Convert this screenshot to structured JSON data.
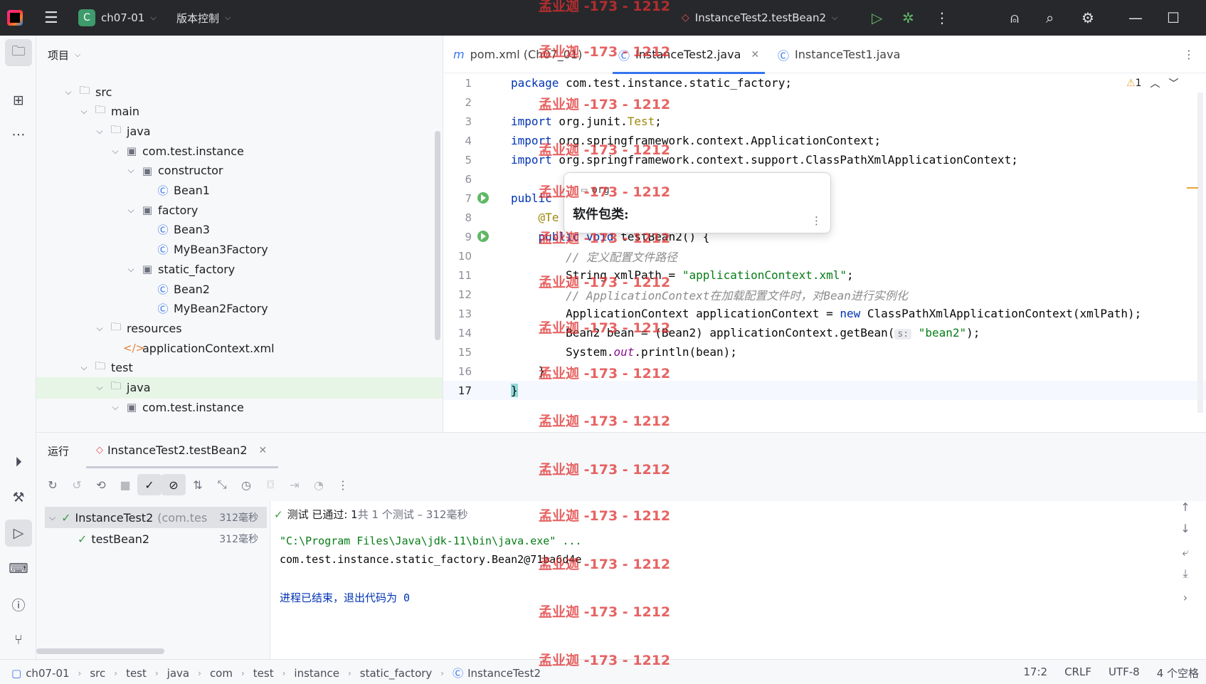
{
  "titlebar": {
    "project_letter": "C",
    "project_name": "ch07-01",
    "vcs_label": "版本控制",
    "run_config": "InstanceTest2.testBean2"
  },
  "project_panel": {
    "title": "项目",
    "tree": [
      {
        "label": "src",
        "depth": 0,
        "icon": "folder-icon"
      },
      {
        "label": "main",
        "depth": 1,
        "icon": "folder-icon"
      },
      {
        "label": "java",
        "depth": 2,
        "icon": "folder-icon"
      },
      {
        "label": "com.test.instance",
        "depth": 3,
        "icon": "package-icon"
      },
      {
        "label": "constructor",
        "depth": 4,
        "icon": "package-icon"
      },
      {
        "label": "Bean1",
        "depth": 5,
        "icon": "class-icon"
      },
      {
        "label": "factory",
        "depth": 4,
        "icon": "package-icon"
      },
      {
        "label": "Bean3",
        "depth": 5,
        "icon": "class-icon"
      },
      {
        "label": "MyBean3Factory",
        "depth": 5,
        "icon": "class-icon"
      },
      {
        "label": "static_factory",
        "depth": 4,
        "icon": "package-icon"
      },
      {
        "label": "Bean2",
        "depth": 5,
        "icon": "class-icon"
      },
      {
        "label": "MyBean2Factory",
        "depth": 5,
        "icon": "class-icon"
      },
      {
        "label": "resources",
        "depth": 2,
        "icon": "folder-icon"
      },
      {
        "label": "applicationContext.xml",
        "depth": 3,
        "icon": "xml-icon"
      },
      {
        "label": "test",
        "depth": 1,
        "icon": "folder-icon"
      },
      {
        "label": "java",
        "depth": 2,
        "icon": "folder-icon"
      },
      {
        "label": "com.test.instance",
        "depth": 3,
        "icon": "package-icon"
      }
    ]
  },
  "editor": {
    "tabs": [
      {
        "label": "pom.xml (Ch07_01)",
        "icon": "maven-icon"
      },
      {
        "label": "InstanceTest2.java",
        "icon": "class-icon",
        "active": true
      },
      {
        "label": "InstanceTest1.java",
        "icon": "class-icon"
      }
    ],
    "warning_count": "1",
    "lines": [
      {
        "n": "1"
      },
      {
        "n": "2"
      },
      {
        "n": "3"
      },
      {
        "n": "4"
      },
      {
        "n": "5"
      },
      {
        "n": "6"
      },
      {
        "n": "7"
      },
      {
        "n": "8"
      },
      {
        "n": "9"
      },
      {
        "n": "10"
      },
      {
        "n": "11"
      },
      {
        "n": "12"
      },
      {
        "n": "13"
      },
      {
        "n": "14"
      },
      {
        "n": "15"
      },
      {
        "n": "16"
      },
      {
        "n": "17"
      }
    ],
    "code": {
      "l1_kw": "package",
      "l1": " com.test.instance.static_factory;",
      "l3_kw": "import",
      "l3a": " org.junit.",
      "l3b": "Test",
      "l3c": ";",
      "l4_kw": "import",
      "l4": " org.springframework.context.ApplicationContext;",
      "l5_kw": "import",
      "l5": " org.springframework.context.support.ClassPathXmlApplicationContext;",
      "l7_kw": "public",
      "l8_ann": "@Te",
      "l9_kw": "public void",
      "l9": " testBean2() {",
      "l10": "// 定义配置文件路径",
      "l11a": "String xmlPath = ",
      "l11b": "\"applicationContext.xml\"",
      "l11c": ";",
      "l12": "// ApplicationContext在加载配置文件时，对Bean进行实例化",
      "l13a": "ApplicationContext applicationContext = ",
      "l13_kw": "new",
      "l13b": " ClassPathXmlApplicationContext(xmlPath);",
      "l14a": "Bean2 bean = (Bean2) applicationContext.getBean(",
      "l14_hint": "s:",
      "l14b": "\"bean2\"",
      "l14c": ");",
      "l15a": "System.",
      "l15_fld": "out",
      "l15b": ".println(bean);",
      "l16": "}",
      "l17": "}"
    },
    "popup": {
      "package": "org",
      "title": "软件包类:"
    }
  },
  "run_panel": {
    "title": "运行",
    "tab": "InstanceTest2.testBean2",
    "tests": [
      {
        "label": "InstanceTest2",
        "sub": "(com.tes",
        "duration": "312毫秒"
      },
      {
        "label": "testBean2",
        "duration": "312毫秒"
      }
    ],
    "status_a": "测试 已通过: 1",
    "status_b": "共 1 个测试 – 312毫秒",
    "console": {
      "cmd": "\"C:\\Program Files\\Java\\jdk-11\\bin\\java.exe\" ...",
      "out": "com.test.instance.static_factory.Bean2@71ba6d4e",
      "exit": "进程已结束，退出代码为 0"
    }
  },
  "statusbar": {
    "crumbs": [
      "ch07-01",
      "src",
      "test",
      "java",
      "com",
      "test",
      "instance",
      "static_factory",
      "InstanceTest2"
    ],
    "position": "17:2",
    "line_sep": "CRLF",
    "encoding": "UTF-8",
    "indent": "4 个空格"
  },
  "watermark": "孟业迦 -173 - 1212"
}
